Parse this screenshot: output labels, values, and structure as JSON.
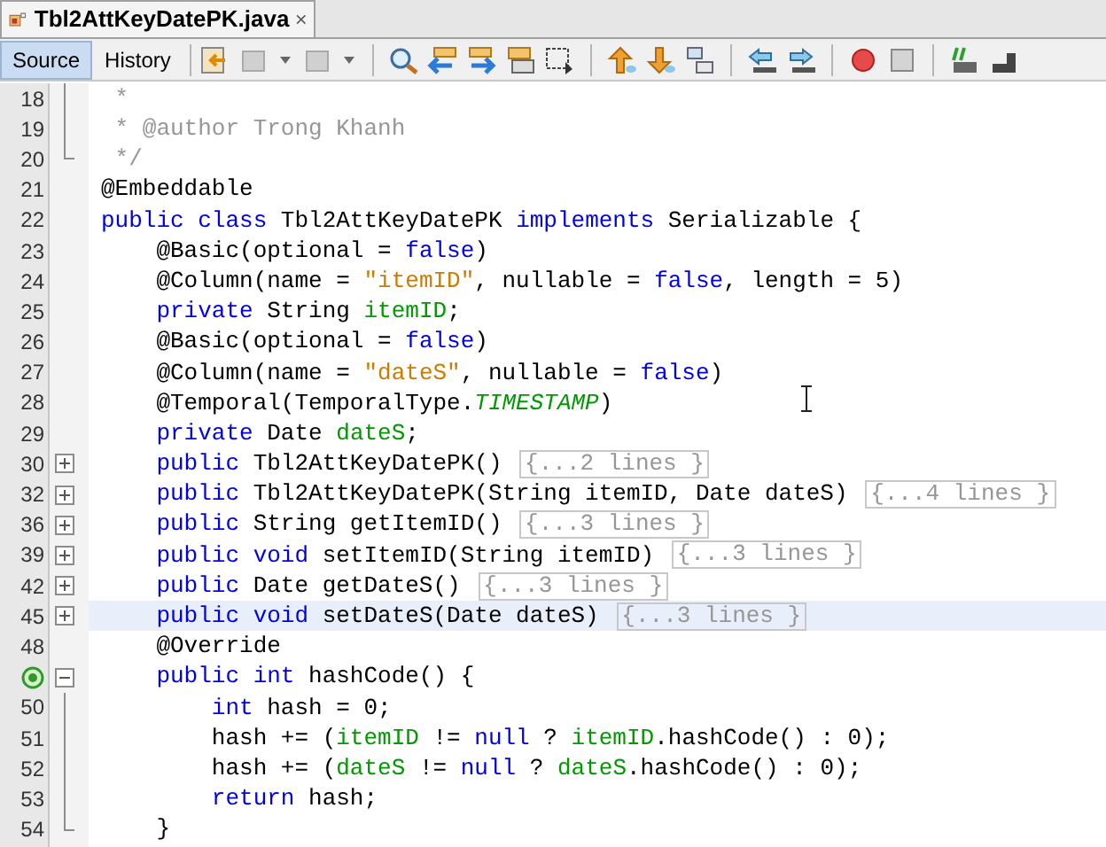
{
  "tab": {
    "title": "Tbl2AttKeyDatePK.java",
    "selected": true
  },
  "view_tabs": [
    {
      "label": "Source",
      "selected": true
    },
    {
      "label": "History",
      "selected": false
    }
  ],
  "lines": [
    {
      "number": "18",
      "kind": "guide",
      "override": false,
      "current": false,
      "tokens": [
        {
          "kind": "comment",
          "text": " *"
        }
      ]
    },
    {
      "number": "19",
      "kind": "guide",
      "override": false,
      "current": false,
      "tokens": [
        {
          "kind": "comment",
          "text": " * @author Trong Khanh"
        }
      ]
    },
    {
      "number": "20",
      "kind": "end",
      "override": false,
      "current": false,
      "tokens": [
        {
          "kind": "comment",
          "text": " */"
        }
      ]
    },
    {
      "number": "21",
      "kind": "plain",
      "override": false,
      "current": false,
      "tokens": [
        {
          "kind": "plain",
          "text": "@Embeddable"
        }
      ]
    },
    {
      "number": "22",
      "kind": "plain",
      "override": false,
      "current": false,
      "tokens": [
        {
          "kind": "keyword",
          "text": "public class"
        },
        {
          "kind": "plain",
          "text": " Tbl2AttKeyDatePK "
        },
        {
          "kind": "keyword",
          "text": "implements"
        },
        {
          "kind": "plain",
          "text": " Serializable {"
        }
      ]
    },
    {
      "number": "23",
      "kind": "plain",
      "override": false,
      "current": false,
      "tokens": [
        {
          "kind": "plain",
          "text": "    @Basic(optional = "
        },
        {
          "kind": "keyword",
          "text": "false"
        },
        {
          "kind": "plain",
          "text": ")"
        }
      ]
    },
    {
      "number": "24",
      "kind": "plain",
      "override": false,
      "current": false,
      "tokens": [
        {
          "kind": "plain",
          "text": "    @Column(name = "
        },
        {
          "kind": "string",
          "text": "\"itemID\""
        },
        {
          "kind": "plain",
          "text": ", nullable = "
        },
        {
          "kind": "keyword",
          "text": "false"
        },
        {
          "kind": "plain",
          "text": ", length = 5)"
        }
      ]
    },
    {
      "number": "25",
      "kind": "plain",
      "override": false,
      "current": false,
      "tokens": [
        {
          "kind": "keyword",
          "text": "    private"
        },
        {
          "kind": "plain",
          "text": " String "
        },
        {
          "kind": "field",
          "text": "itemID"
        },
        {
          "kind": "plain",
          "text": ";"
        }
      ]
    },
    {
      "number": "26",
      "kind": "plain",
      "override": false,
      "current": false,
      "tokens": [
        {
          "kind": "plain",
          "text": "    @Basic(optional = "
        },
        {
          "kind": "keyword",
          "text": "false"
        },
        {
          "kind": "plain",
          "text": ")"
        }
      ]
    },
    {
      "number": "27",
      "kind": "plain",
      "override": false,
      "current": false,
      "tokens": [
        {
          "kind": "plain",
          "text": "    @Column(name = "
        },
        {
          "kind": "string",
          "text": "\"dateS\""
        },
        {
          "kind": "plain",
          "text": ", nullable = "
        },
        {
          "kind": "keyword",
          "text": "false"
        },
        {
          "kind": "plain",
          "text": ")"
        }
      ]
    },
    {
      "number": "28",
      "kind": "plain",
      "override": false,
      "current": false,
      "tokens": [
        {
          "kind": "plain",
          "text": "    @Temporal(TemporalType."
        },
        {
          "kind": "constant",
          "text": "TIMESTAMP"
        },
        {
          "kind": "plain",
          "text": ")"
        }
      ]
    },
    {
      "number": "29",
      "kind": "plain",
      "override": false,
      "current": false,
      "tokens": [
        {
          "kind": "keyword",
          "text": "    private"
        },
        {
          "kind": "plain",
          "text": " Date "
        },
        {
          "kind": "field",
          "text": "dateS"
        },
        {
          "kind": "plain",
          "text": ";"
        }
      ]
    },
    {
      "number": "30",
      "kind": "collapsed",
      "override": false,
      "current": false,
      "tokens": [
        {
          "kind": "keyword",
          "text": "    public"
        },
        {
          "kind": "plain",
          "text": " Tbl2AttKeyDatePK() "
        },
        {
          "kind": "folded",
          "text": "{...2 lines }"
        }
      ]
    },
    {
      "number": "32",
      "kind": "collapsed",
      "override": false,
      "current": false,
      "tokens": [
        {
          "kind": "keyword",
          "text": "    public"
        },
        {
          "kind": "plain",
          "text": " Tbl2AttKeyDatePK(String itemID, Date dateS) "
        },
        {
          "kind": "folded",
          "text": "{...4 lines }"
        }
      ]
    },
    {
      "number": "36",
      "kind": "collapsed",
      "override": false,
      "current": false,
      "tokens": [
        {
          "kind": "keyword",
          "text": "    public"
        },
        {
          "kind": "plain",
          "text": " String getItemID() "
        },
        {
          "kind": "folded",
          "text": "{...3 lines }"
        }
      ]
    },
    {
      "number": "39",
      "kind": "collapsed",
      "override": false,
      "current": false,
      "tokens": [
        {
          "kind": "keyword",
          "text": "    public void"
        },
        {
          "kind": "plain",
          "text": " setItemID(String itemID) "
        },
        {
          "kind": "folded",
          "text": "{...3 lines }"
        }
      ]
    },
    {
      "number": "42",
      "kind": "collapsed",
      "override": false,
      "current": false,
      "tokens": [
        {
          "kind": "keyword",
          "text": "    public"
        },
        {
          "kind": "plain",
          "text": " Date getDateS() "
        },
        {
          "kind": "folded",
          "text": "{...3 lines }"
        }
      ]
    },
    {
      "number": "45",
      "kind": "collapsed",
      "override": false,
      "current": true,
      "tokens": [
        {
          "kind": "keyword",
          "text": "    public void"
        },
        {
          "kind": "plain",
          "text": " setDateS(Date dateS) "
        },
        {
          "kind": "folded",
          "text": "{...3 lines }"
        }
      ]
    },
    {
      "number": "48",
      "kind": "plain",
      "override": false,
      "current": false,
      "tokens": [
        {
          "kind": "plain",
          "text": "    @Override"
        }
      ]
    },
    {
      "kind": "expanded",
      "override": true,
      "current": false,
      "tokens": [
        {
          "kind": "keyword",
          "text": "    public int"
        },
        {
          "kind": "plain",
          "text": " hashCode() {"
        }
      ]
    },
    {
      "number": "50",
      "kind": "guide",
      "override": false,
      "current": false,
      "tokens": [
        {
          "kind": "keyword",
          "text": "        int"
        },
        {
          "kind": "plain",
          "text": " hash = 0;"
        }
      ]
    },
    {
      "number": "51",
      "kind": "guide",
      "override": false,
      "current": false,
      "tokens": [
        {
          "kind": "plain",
          "text": "        hash += ("
        },
        {
          "kind": "field",
          "text": "itemID"
        },
        {
          "kind": "plain",
          "text": " != "
        },
        {
          "kind": "keyword",
          "text": "null"
        },
        {
          "kind": "plain",
          "text": " ? "
        },
        {
          "kind": "field",
          "text": "itemID"
        },
        {
          "kind": "plain",
          "text": ".hashCode() : 0);"
        }
      ]
    },
    {
      "number": "52",
      "kind": "guide",
      "override": false,
      "current": false,
      "tokens": [
        {
          "kind": "plain",
          "text": "        hash += ("
        },
        {
          "kind": "field",
          "text": "dateS"
        },
        {
          "kind": "plain",
          "text": " != "
        },
        {
          "kind": "keyword",
          "text": "null"
        },
        {
          "kind": "plain",
          "text": " ? "
        },
        {
          "kind": "field",
          "text": "dateS"
        },
        {
          "kind": "plain",
          "text": ".hashCode() : 0);"
        }
      ]
    },
    {
      "number": "53",
      "kind": "guide",
      "override": false,
      "current": false,
      "tokens": [
        {
          "kind": "keyword",
          "text": "        return"
        },
        {
          "kind": "plain",
          "text": " hash;"
        }
      ]
    },
    {
      "number": "54",
      "kind": "end",
      "override": false,
      "current": false,
      "tokens": [
        {
          "kind": "plain",
          "text": "    }"
        }
      ]
    }
  ]
}
